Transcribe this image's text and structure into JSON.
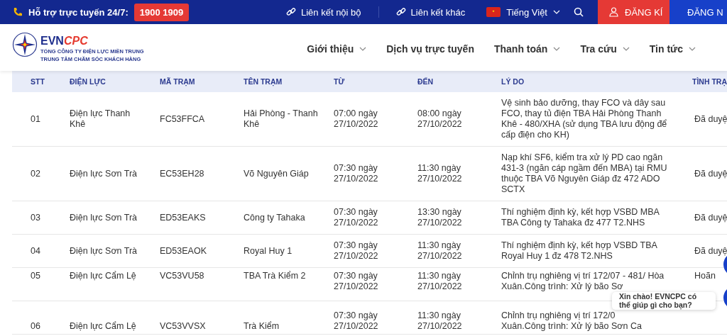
{
  "top_bar": {
    "support_label": "Hỗ trợ trực tuyến 24/7:",
    "hotline": "1900 1909",
    "links": [
      "Liên kết nội bộ",
      "Liên kết khác"
    ],
    "language": "Tiếng Việt",
    "register": "ĐĂNG KÍ",
    "login": "ĐĂNG N"
  },
  "logo": {
    "brand_a": "EVN",
    "brand_b": "CPC",
    "line_1": "TỔNG CÔNG TY ĐIỆN LỰC MIỀN TRUNG",
    "line_2": "TRUNG TÂM CHĂM SÓC KHÁCH HÀNG"
  },
  "nav": [
    {
      "label": "Giới thiệu",
      "has_menu": true
    },
    {
      "label": "Dịch vụ trực tuyến",
      "has_menu": false
    },
    {
      "label": "Thanh toán",
      "has_menu": true
    },
    {
      "label": "Tra cứu",
      "has_menu": true
    },
    {
      "label": "Tin tức",
      "has_menu": true
    }
  ],
  "table": {
    "columns": [
      "STT",
      "ĐIỆN LỰC",
      "MÃ TRẠM",
      "TÊN TRẠM",
      "TỪ",
      "ĐẾN",
      "LÝ DO",
      "TÌNH TRẠ"
    ],
    "rows": [
      {
        "stt": "01",
        "unit": "Điện lực Thanh\nKhê",
        "code": "FC53FFCA",
        "station": "Hải Phòng - Thanh\nKhê",
        "from": "07:00 ngày\n27/10/2022",
        "to": "08:00 ngày\n27/10/2022",
        "reason": "Vệ sinh bảo dưỡng, thay FCO và dây sau\nFCO, thay tủ điện TBA Hải Phòng Thanh\nKhê - 480/XHA (sử dụng TBA lưu động để\ncấp điện cho KH)",
        "status": "Đã duyệ"
      },
      {
        "stt": "02",
        "unit": "Điện lực Sơn Trà",
        "code": "EC53EH28",
        "station": "Võ Nguyên Giáp",
        "from": "07:30 ngày\n27/10/2022",
        "to": "11:30 ngày\n27/10/2022",
        "reason": "Nạp khí SF6, kiểm tra xử lý PD cao ngăn\n431-3 (ngăn cáp ngầm đến MBA) tại RMU\nthuộc TBA Võ Nguyên Giáp đz 472 ADO\nSCTX",
        "status": "Đã duyệ"
      },
      {
        "stt": "03",
        "unit": "Điện lực Sơn Trà",
        "code": "ED53EAKS",
        "station": "Công ty Tahaka",
        "from": "07:30 ngày\n27/10/2022",
        "to": "13:30 ngày\n27/10/2022",
        "reason": "Thí nghiệm định kỳ, kết hợp VSBD MBA\nTBA Công ty Tahaka đz 477 T2.NHS",
        "status": "Đã duyệ"
      },
      {
        "stt": "04",
        "unit": "Điện lực Sơn Trà",
        "code": "ED53EAOK",
        "station": "Royal Huy 1",
        "from": "07:30 ngày\n27/10/2022",
        "to": "11:30 ngày\n27/10/2022",
        "reason": "Thí nghiệm định kỳ, kết hợp VSBD TBA\nRoyal Huy 1 đz 478 T2.NHS",
        "status": "Đã duyệ"
      },
      {
        "stt": "05",
        "unit": "Điện lực Cẩm Lệ",
        "code": "VC53VU58",
        "station": "TBA Trà Kiểm 2",
        "from": "07:30 ngày\n27/10/2022",
        "to": "11:30 ngày\n27/10/2022",
        "reason": "Chỉnh trụ nghiêng vị trí 172/07 - 481/ Hòa\nXuân.Công trình: Xử lý bão Sơ",
        "status": "Hoãn"
      },
      {
        "stt": "06",
        "unit": "Điện lực Cẩm Lệ",
        "code": "VC53VVSX",
        "station": "Trà Kiểm",
        "from": "07:30 ngày\n27/10/2022",
        "to": "11:30 ngày\n27/10/2022",
        "reason": "Chỉnh trụ nghiêng vị trí 172/0\nXuân.Công trình: Xử lý bão Sơn Ca"
      }
    ]
  },
  "chat": {
    "message": "Xin chào! EVNCPC có thể giúp gì cho bạn?"
  }
}
